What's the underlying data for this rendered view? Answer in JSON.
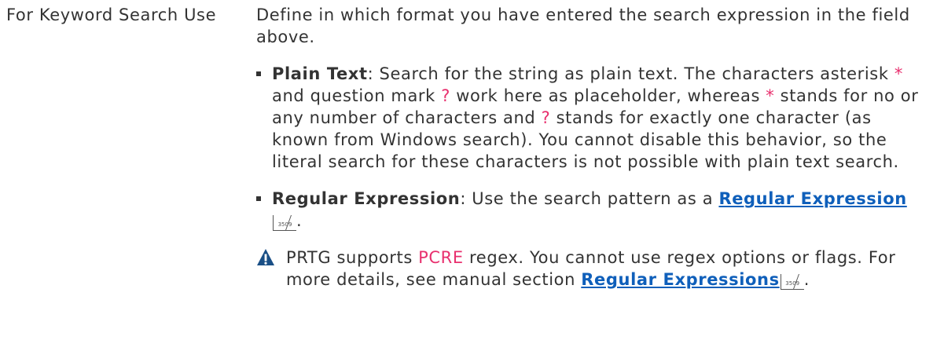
{
  "setting": {
    "label": "For Keyword Search Use",
    "description": "Define in which format you have entered the search expression in the field above.",
    "options": [
      {
        "name": "Plain Text",
        "text_1": ": Search for the string as plain text. The characters asterisk ",
        "asterisk": "*",
        "text_2": " and question mark ",
        "question": "?",
        "text_3": " work here as placeholder, whereas ",
        "text_4": " stands for no or any number of characters and ",
        "text_5": " stands for exactly one character (as known from Windows search). You cannot disable this behavior, so the literal search for these characters is not possible with plain text search."
      },
      {
        "name": "Regular Expression",
        "text_1": ": Use the search pattern as a ",
        "link_text": "Regular Expression",
        "page_ref": "3509",
        "text_2": "."
      }
    ],
    "note": {
      "icon": "warning-icon",
      "text_1": "PRTG supports ",
      "pcre": "PCRE",
      "text_2": " regex. You cannot use regex options or flags. For more details, see manual section ",
      "link_text": "Regular Expressions",
      "page_ref": "3509",
      "text_3": "."
    }
  },
  "colors": {
    "text": "#333333",
    "accent_pink": "#e8306e",
    "link": "#0f5fba",
    "note_icon": "#1a4f86"
  }
}
